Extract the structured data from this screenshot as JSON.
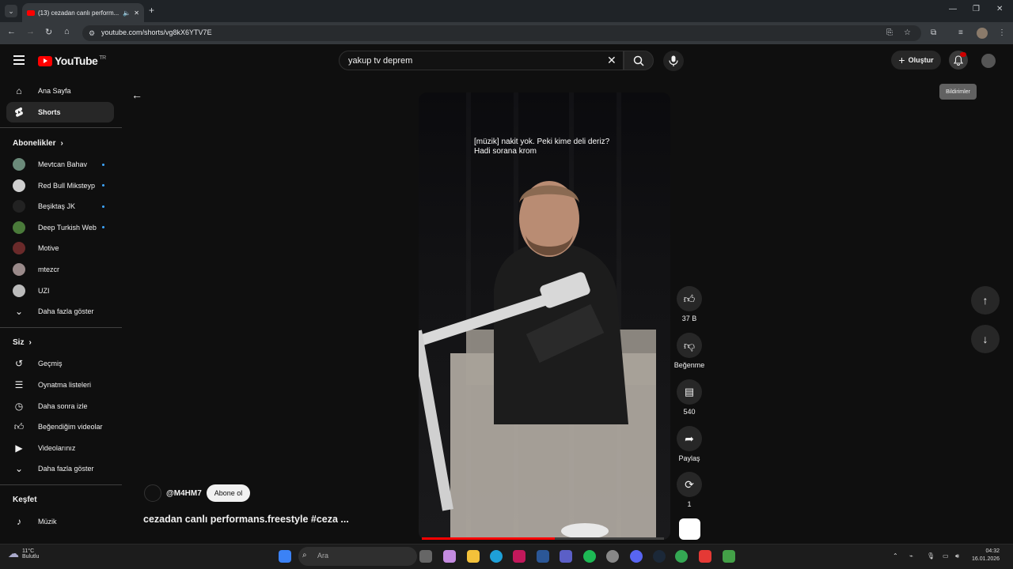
{
  "browser": {
    "tab_title": "(13) cezadan canlı perform...",
    "url": "youtube.com/shorts/vg8kX6YTV7E"
  },
  "header": {
    "logo_text": "YouTube",
    "country": "TR",
    "search_value": "yakup tv deprem",
    "create_label": "Oluştur",
    "notification_tooltip": "Bildirimler"
  },
  "sidebar": {
    "main": [
      {
        "label": "Ana Sayfa",
        "icon": "home-icon"
      },
      {
        "label": "Shorts",
        "icon": "shorts-icon"
      }
    ],
    "subscriptions_title": "Abonelikler",
    "subscriptions": [
      {
        "label": "Mevtcan Bahav",
        "color": "#6b8a7a",
        "dot": true
      },
      {
        "label": "Red Bull Miksteyp",
        "color": "#cfcfcf",
        "dot": true
      },
      {
        "label": "Beşiktaş JK",
        "color": "#222222",
        "dot": true
      },
      {
        "label": "Deep Turkish Web",
        "color": "#4a7a3a",
        "dot": true
      },
      {
        "label": "Motive",
        "color": "#6a2a2a",
        "dot": false
      },
      {
        "label": "mtezcr",
        "color": "#9a8a8a",
        "dot": false
      },
      {
        "label": "UZI",
        "color": "#bbbbbb",
        "dot": false
      }
    ],
    "subs_more": "Daha fazla göster",
    "you_title": "Siz",
    "you": [
      {
        "label": "Geçmiş",
        "icon": "history-icon"
      },
      {
        "label": "Oynatma listeleri",
        "icon": "playlist-icon"
      },
      {
        "label": "Daha sonra izle",
        "icon": "clock-icon"
      },
      {
        "label": "Beğendiğim videolar",
        "icon": "thumbs-up-icon"
      },
      {
        "label": "Videolarınız",
        "icon": "video-icon"
      }
    ],
    "you_more": "Daha fazla göster",
    "explore_title": "Keşfet",
    "explore": [
      {
        "label": "Müzik",
        "icon": "music-icon"
      }
    ]
  },
  "video": {
    "caption_line1": "[müzik] nakit yok. Peki kime deli deriz?",
    "caption_line2": "Hadi sorana krom",
    "channel": "@M4HM7",
    "subscribe_label": "Abone ol",
    "title": "cezadan canlı performans.freestyle #ceza ...",
    "progress": 0.55
  },
  "actions": {
    "likes": "37 B",
    "dislike_label": "Beğenme",
    "comments": "540",
    "share_label": "Paylaş",
    "remix": "1"
  },
  "taskbar": {
    "temp": "11°C",
    "condition": "Bulutlu",
    "search_placeholder": "Ara",
    "time": "04:32",
    "date": "16.01.2026"
  }
}
